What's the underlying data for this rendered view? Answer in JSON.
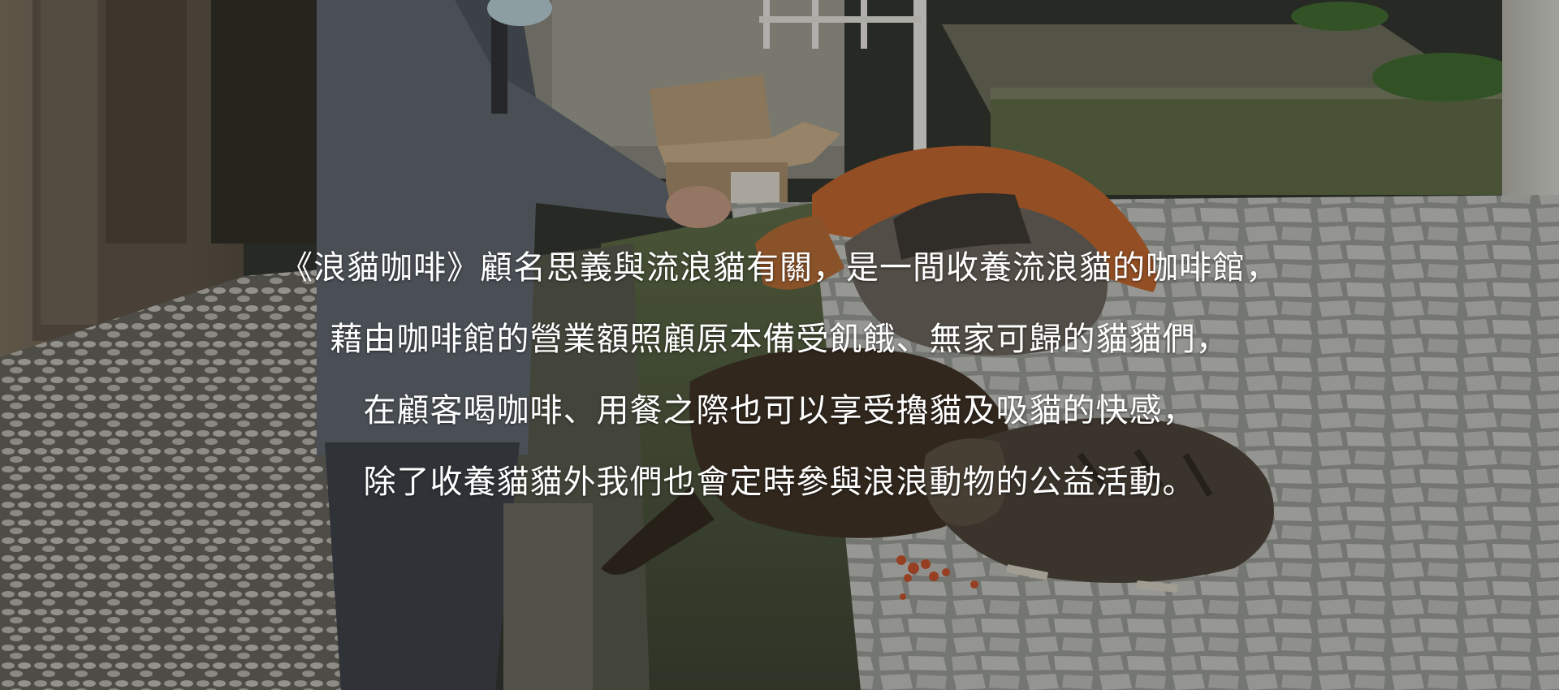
{
  "intro": {
    "lines": [
      "《浪貓咖啡》顧名思義與流浪貓有關，是一間收養流浪貓的咖啡館，",
      "藉由咖啡館的營業額照顧原本備受飢餓、無家可歸的貓貓們，",
      "在顧客喝咖啡、用餐之際也可以享受擼貓及吸貓的快感，",
      "除了收養貓貓外我們也會定時參與浪浪動物的公益活動。"
    ]
  },
  "colors": {
    "text": "#ffffff",
    "overlay": "rgba(20,22,18,0.28)"
  }
}
